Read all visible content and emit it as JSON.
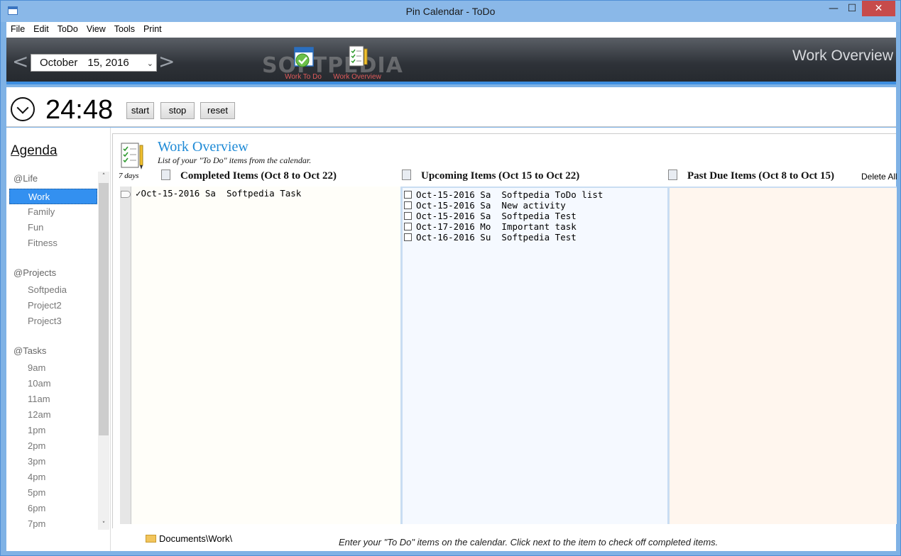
{
  "window": {
    "title": "Pin Calendar - ToDo",
    "minimize": "—",
    "maximize": "☐",
    "close": "✕"
  },
  "menu": [
    "File",
    "Edit",
    "ToDo",
    "View",
    "Tools",
    "Print"
  ],
  "banner": {
    "prev_arrow": "<",
    "next_arrow": ">",
    "date_month": "October",
    "date_day": "15, 2016",
    "caret": "⌄",
    "watermark": "SOFTPEDIA",
    "toolbar": [
      {
        "label": "Work To Do",
        "icon": "calendar-check-icon"
      },
      {
        "label": "Work Overview",
        "icon": "checklist-pencil-icon"
      }
    ],
    "heading": "Work Overview"
  },
  "timer": {
    "value": "24:48",
    "start": "start",
    "stop": "stop",
    "reset": "reset"
  },
  "sidebar": {
    "title": "Agenda",
    "groups": [
      {
        "label": "@Life",
        "items": [
          "Work",
          "Family",
          "Fun",
          "Fitness"
        ]
      },
      {
        "label": "@Projects",
        "items": [
          "Softpedia",
          "Project2",
          "Project3"
        ]
      },
      {
        "label": "@Tasks",
        "items": [
          "9am",
          "10am",
          "11am",
          "12am",
          "1pm",
          "2pm",
          "3pm",
          "4pm",
          "5pm",
          "6pm",
          "7pm"
        ]
      }
    ],
    "selected": "Work",
    "scroll_up": "˄",
    "scroll_down": "˅"
  },
  "overview": {
    "title": "Work Overview",
    "subtitle": "List of your \"To Do\" items from the calendar.",
    "days": "7 days",
    "columns": {
      "completed": {
        "heading": "Completed Items  (Oct 8 to Oct 22)"
      },
      "upcoming": {
        "heading": "Upcoming Items  (Oct 15 to Oct 22)"
      },
      "pastdue": {
        "heading": "Past Due Items  (Oct 8 to Oct 15)"
      }
    },
    "delete_all": "Delete All",
    "completed_items": [
      {
        "mark": "✓",
        "text": "Oct-15-2016 Sa  Softpedia Task"
      }
    ],
    "upcoming_items": [
      "Oct-15-2016 Sa  Softpedia ToDo list",
      "Oct-15-2016 Sa  New activity",
      "Oct-15-2016 Sa  Softpedia Test",
      "Oct-17-2016 Mo  Important task",
      "Oct-16-2016 Su  Softpedia Test"
    ]
  },
  "status": {
    "path": "Documents\\Work\\",
    "hint": "Enter your \"To Do\" items on the calendar. Click next to the item to check off completed items."
  }
}
